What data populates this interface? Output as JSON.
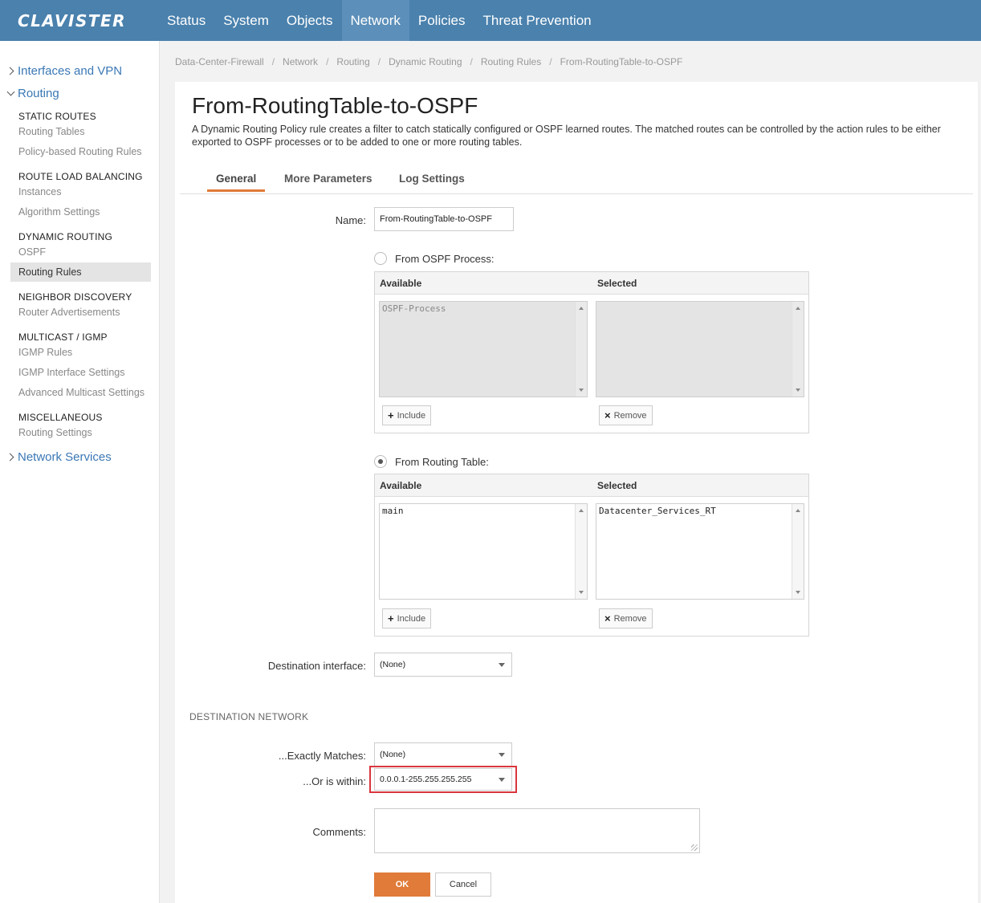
{
  "topbar": {
    "logo": "CLAVISTER",
    "nav": [
      "Status",
      "System",
      "Objects",
      "Network",
      "Policies",
      "Threat Prevention"
    ],
    "active": "Network",
    "color": "#4a81ad"
  },
  "sidebar": {
    "interfaces_vpn": "Interfaces and VPN",
    "routing": "Routing",
    "network_services": "Network Services",
    "sections": {
      "static_routes": "STATIC ROUTES",
      "route_load_balancing": "ROUTE LOAD BALANCING",
      "dynamic_routing": "DYNAMIC ROUTING",
      "neighbor_discovery": "NEIGHBOR DISCOVERY",
      "multicast_igmp": "MULTICAST / IGMP",
      "miscellaneous": "MISCELLANEOUS"
    },
    "links": {
      "routing_tables": "Routing Tables",
      "policy_based_routing_rules": "Policy-based Routing Rules",
      "instances": "Instances",
      "algorithm_settings": "Algorithm Settings",
      "ospf": "OSPF",
      "routing_rules": "Routing Rules",
      "router_advertisements": "Router Advertisements",
      "igmp_rules": "IGMP Rules",
      "igmp_interface_settings": "IGMP Interface Settings",
      "advanced_multicast_settings": "Advanced Multicast Settings",
      "routing_settings": "Routing Settings"
    }
  },
  "breadcrumb": [
    "Data-Center-Firewall",
    "Network",
    "Routing",
    "Dynamic Routing",
    "Routing Rules",
    "From-RoutingTable-to-OSPF"
  ],
  "page": {
    "title": "From-RoutingTable-to-OSPF",
    "description": "A Dynamic Routing Policy rule creates a filter to catch statically configured or OSPF learned routes. The matched routes can be controlled by the action rules to be either exported to OSPF processes or to be added to one or more routing tables."
  },
  "tabs": [
    "General",
    "More Parameters",
    "Log Settings"
  ],
  "active_tab": "General",
  "form": {
    "name_label": "Name:",
    "name_value": "From-RoutingTable-to-OSPF",
    "ospf_radio_label": "From OSPF Process:",
    "ospf_selected": false,
    "rt_radio_label": "From Routing Table:",
    "rt_selected": true,
    "available_label": "Available",
    "selected_label": "Selected",
    "ospf_available": "OSPF-Process",
    "ospf_selected_items": "",
    "rt_available": "main",
    "rt_selected_items": "Datacenter_Services_RT",
    "include_label": "Include",
    "remove_label": "Remove",
    "dest_interface_label": "Destination interface:",
    "dest_interface_value": "(None)",
    "dest_network_title": "DESTINATION NETWORK",
    "exactly_matches_label": "...Exactly Matches:",
    "exactly_matches_value": "(None)",
    "or_is_within_label": "...Or is within:",
    "or_is_within_value": "0.0.0.1-255.255.255.255",
    "comments_label": "Comments:",
    "comments_value": "",
    "ok_label": "OK",
    "cancel_label": "Cancel"
  },
  "colors": {
    "accent": "#e07b39",
    "highlight": "#d9363e",
    "link": "#3a78b5"
  }
}
